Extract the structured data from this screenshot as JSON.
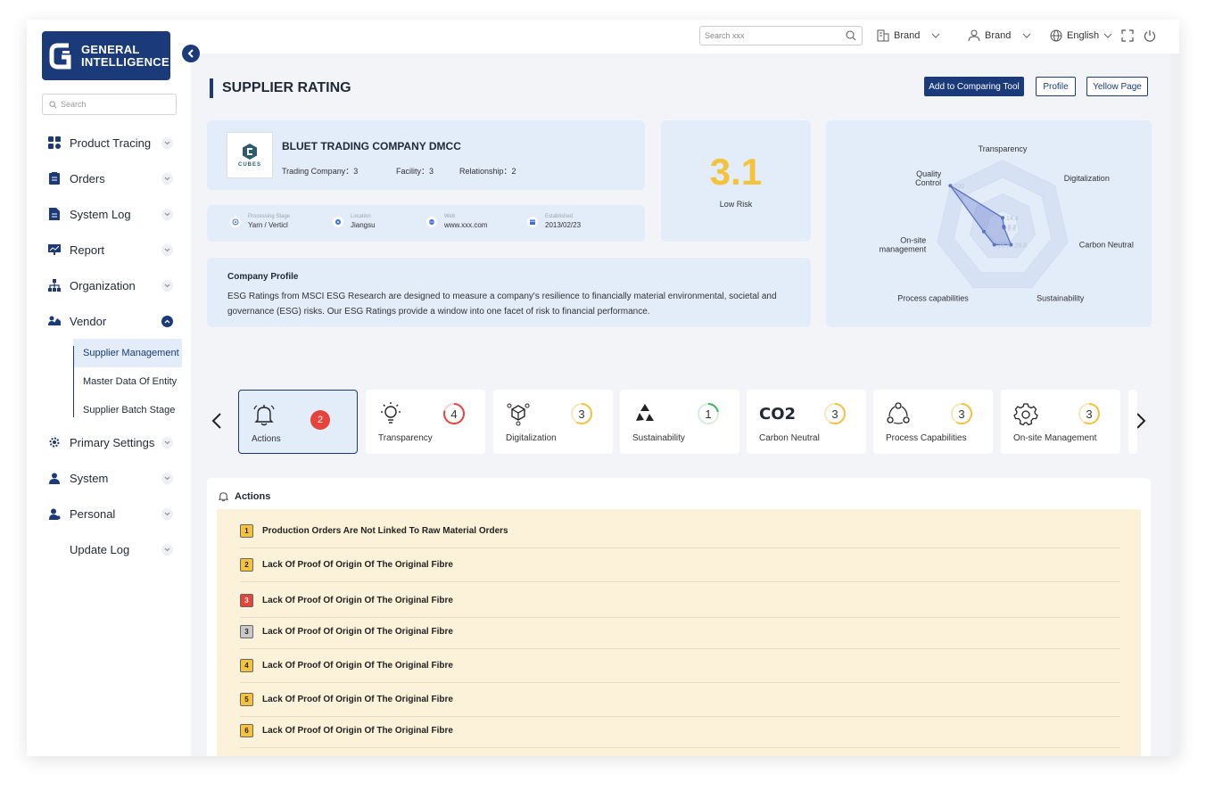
{
  "brand": {
    "line1": "GENERAL",
    "line2": "INTELLIGENCE"
  },
  "sidebar": {
    "search_placeholder": "Search",
    "items": [
      {
        "label": "Product Tracing"
      },
      {
        "label": "Orders"
      },
      {
        "label": "System Log"
      },
      {
        "label": "Report"
      },
      {
        "label": "Organization"
      },
      {
        "label": "Vendor"
      },
      {
        "label": "Primary Settings"
      },
      {
        "label": "System"
      },
      {
        "label": "Personal"
      },
      {
        "label": "Update Log"
      }
    ],
    "vendor_sub": [
      "Supplier Management",
      "Master Data Of Entity",
      "Supplier Batch Stage"
    ]
  },
  "header": {
    "search_placeholder": "Search xxx",
    "brand1": "Brand",
    "brand2": "Brand",
    "language": "English"
  },
  "page": {
    "title": "SUPPLIER RATING",
    "btn_compare": "Add to Comparing Tool",
    "btn_profile": "Profile",
    "btn_yellow": "Yellow Page"
  },
  "company": {
    "logo_text": "CUBES",
    "name": "BLUET TRADING COMPANY DMCC",
    "trading": "Trading Company：3",
    "facility": "Facility：3",
    "relationship": "Relationship：2",
    "info": [
      {
        "label": "Processing Stage",
        "value": "Yarn / Verticl"
      },
      {
        "label": "Location",
        "value": "Jiangsu"
      },
      {
        "label": "Web",
        "value": "www.xxx.com"
      },
      {
        "label": "Established",
        "value": "2013/02/23"
      }
    ]
  },
  "score": {
    "value": "3.1",
    "label": "Low Risk"
  },
  "profile": {
    "title": "Company Profile",
    "text": "ESG Ratings from MSCI ESG Research are designed to measure a company's resilience to financially material environmental, societal and governance (ESG) risks. Our ESG Ratings provide a window into one facet of risk to financial performance."
  },
  "chart_data": {
    "type": "radar",
    "axes": [
      "Transparency",
      "Digitalization",
      "Carbon Neutral",
      "Sustainability",
      "Process capabilities",
      "On-site management",
      "Quality Control"
    ],
    "values": [
      14.4,
      2.2,
      2.2,
      28.8,
      28.8,
      28.8,
      100
    ],
    "max": 100,
    "color": "#5b73c7"
  },
  "categories": [
    {
      "name": "Actions",
      "count": "2"
    },
    {
      "name": "Transparency",
      "count": "4"
    },
    {
      "name": "Digitalization",
      "count": "3"
    },
    {
      "name": "Sustainability",
      "count": "1"
    },
    {
      "name": "Carbon Neutral",
      "count": "3",
      "icon_text": "CO2"
    },
    {
      "name": "Process Capabilities",
      "count": "3"
    },
    {
      "name": "On-site Management",
      "count": "3"
    }
  ],
  "actions": {
    "title": "Actions",
    "rows": [
      {
        "num": "1",
        "text": "Production Orders Are Not Linked To Raw Material Orders",
        "color": "#f5c23c"
      },
      {
        "num": "2",
        "text": "Lack Of Proof Of Origin Of The Original Fibre",
        "color": "#f5c23c"
      },
      {
        "num": "3",
        "text": "Lack Of Proof Of Origin Of The Original Fibre",
        "color": "#e5443a"
      },
      {
        "num": "3",
        "text": "Lack Of Proof Of Origin Of The Original Fibre",
        "color": "#c9c9c9"
      },
      {
        "num": "4",
        "text": "Lack Of Proof Of Origin Of The Original Fibre",
        "color": "#f5c23c"
      },
      {
        "num": "5",
        "text": "Lack Of Proof Of Origin Of The Original Fibre",
        "color": "#f5c23c"
      },
      {
        "num": "6",
        "text": "Lack Of Proof Of Origin Of The Original Fibre",
        "color": "#f5c23c"
      }
    ]
  },
  "colors": {
    "accent": "#1a3a7a",
    "score": "#f5c23c",
    "card": "#e3ecf9"
  }
}
